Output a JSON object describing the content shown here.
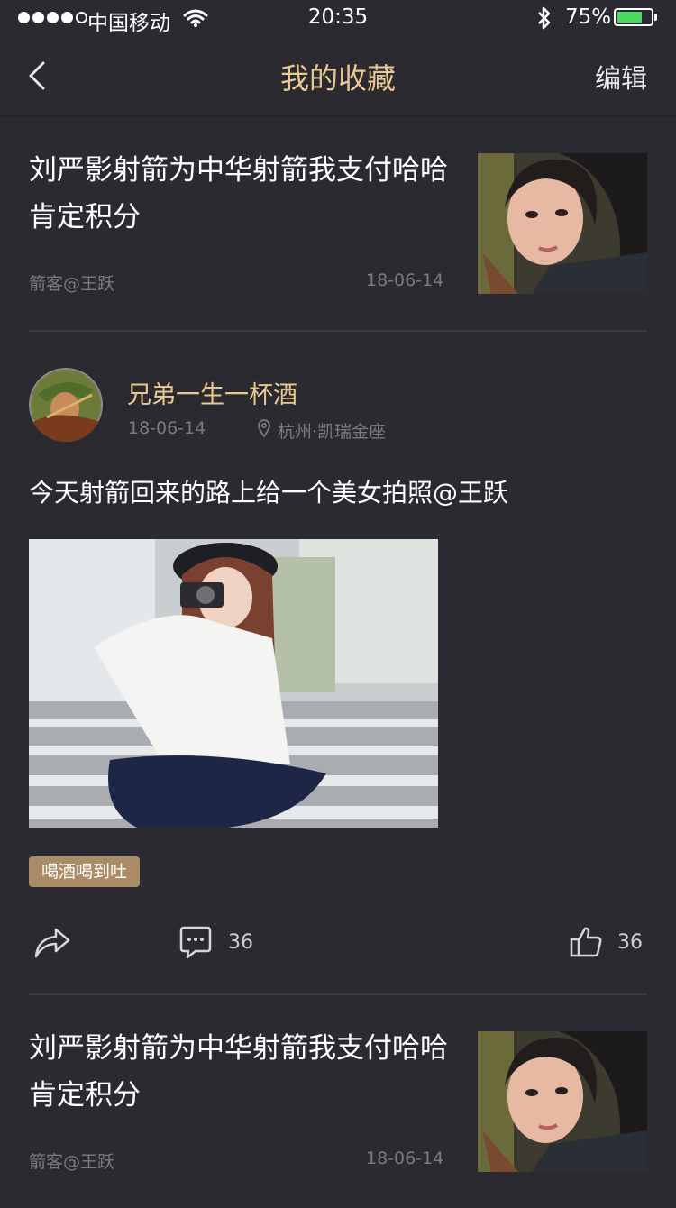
{
  "status_bar": {
    "carrier": "中国移动",
    "time": "20:35",
    "battery_percent": "75%",
    "battery_level": 0.75
  },
  "nav": {
    "title": "我的收藏",
    "edit": "编辑"
  },
  "articles": [
    {
      "title": "刘严影射箭为中华射箭我支付哈哈肯定积分",
      "author": "箭客@王跃",
      "date": "18-06-14"
    },
    {
      "title": "刘严影射箭为中华射箭我支付哈哈肯定积分",
      "author": "箭客@王跃",
      "date": "18-06-14"
    }
  ],
  "post": {
    "username": "兄弟一生一杯酒",
    "date": "18-06-14",
    "location": "杭州·凯瑞金座",
    "text": "今天射箭回来的路上给一个美女拍照@王跃",
    "tag": "喝酒喝到吐",
    "comment_count": "36",
    "like_count": "36"
  },
  "icons": {
    "back": "chevron-left-icon",
    "wifi": "wifi-icon",
    "bluetooth": "bluetooth-icon",
    "share": "share-icon",
    "comment": "comment-icon",
    "like": "thumbs-up-icon",
    "location": "location-pin-icon"
  },
  "colors": {
    "background": "#2b2a30",
    "accent": "#e9c993",
    "tag_bg": "#a98c66",
    "secondary_text": "#7b7a80"
  }
}
